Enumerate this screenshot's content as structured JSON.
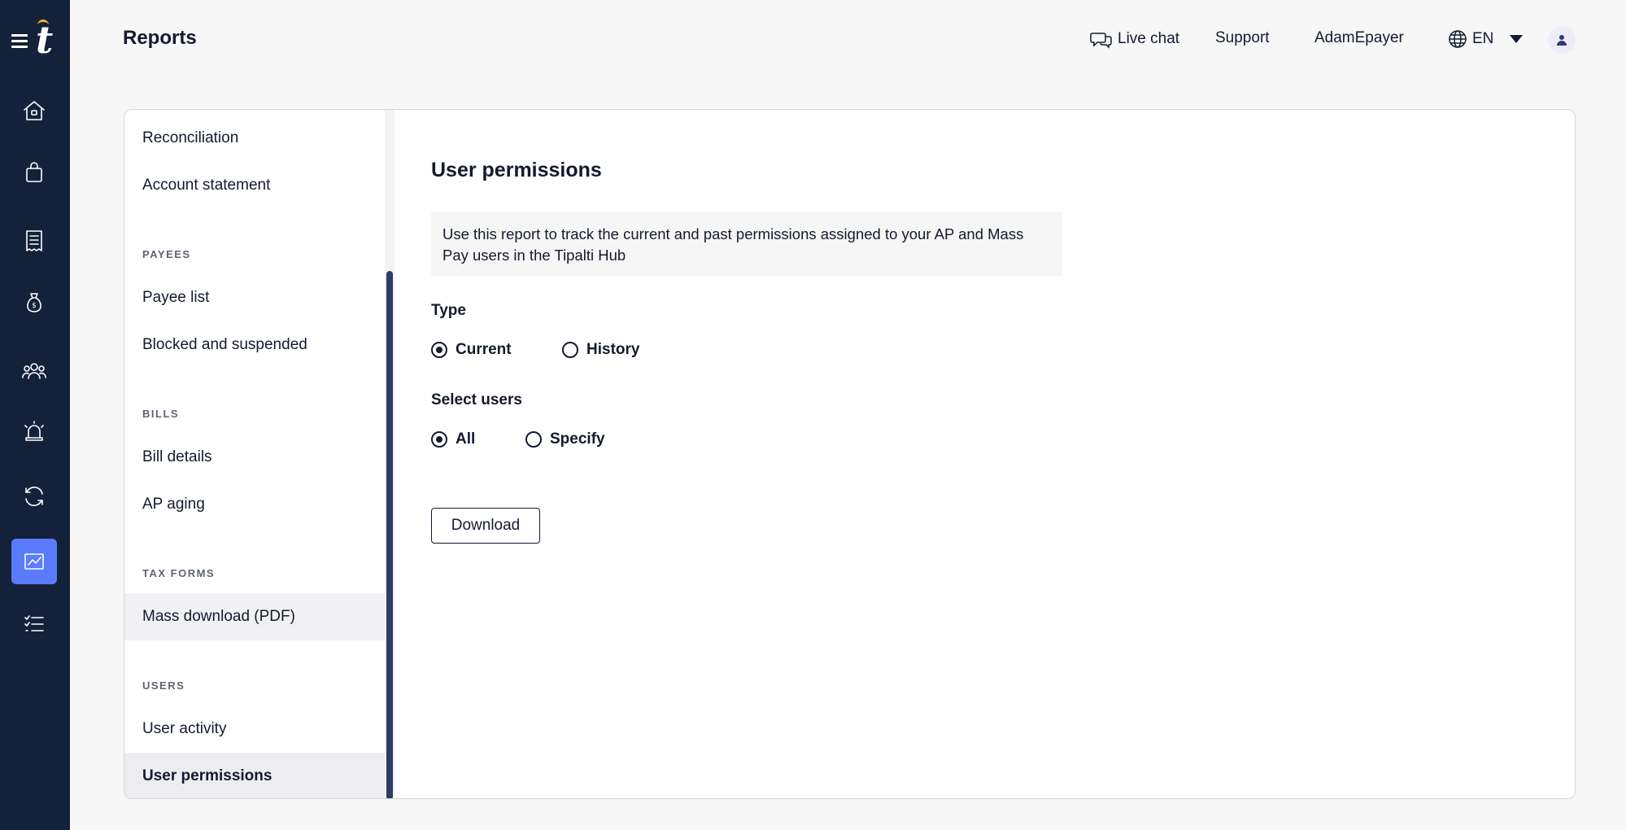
{
  "header": {
    "title": "Reports",
    "live_chat": "Live chat",
    "support": "Support",
    "username": "AdamEpayer",
    "language": "EN"
  },
  "rail": {
    "icons": [
      "home-icon",
      "shopping-bag-icon",
      "receipt-icon",
      "money-bag-icon",
      "users-icon",
      "alarm-icon",
      "sync-icon",
      "reports-chart-icon",
      "tasks-list-icon"
    ],
    "active": "reports-chart-icon",
    "accent": "#5b7bff"
  },
  "sidebar": {
    "items": [
      {
        "label": "Reconciliation"
      },
      {
        "label": "Account statement"
      }
    ],
    "sections": [
      {
        "label": "PAYEES",
        "items": [
          "Payee list",
          "Blocked and suspended"
        ]
      },
      {
        "label": "BILLS",
        "items": [
          "Bill details",
          "AP aging"
        ]
      },
      {
        "label": "TAX FORMS",
        "items": [
          "Mass download (PDF)"
        ]
      },
      {
        "label": "USERS",
        "items": [
          "User activity",
          "User permissions"
        ]
      }
    ],
    "active_item": "User permissions"
  },
  "main": {
    "title": "User permissions",
    "description": "Use this report to track the current and past permissions assigned to your AP and Mass Pay users in the Tipalti Hub",
    "type_label": "Type",
    "type_options": [
      "Current",
      "History"
    ],
    "type_selected": "Current",
    "users_label": "Select users",
    "users_options": [
      "All",
      "Specify"
    ],
    "users_selected": "All",
    "download_label": "Download"
  }
}
